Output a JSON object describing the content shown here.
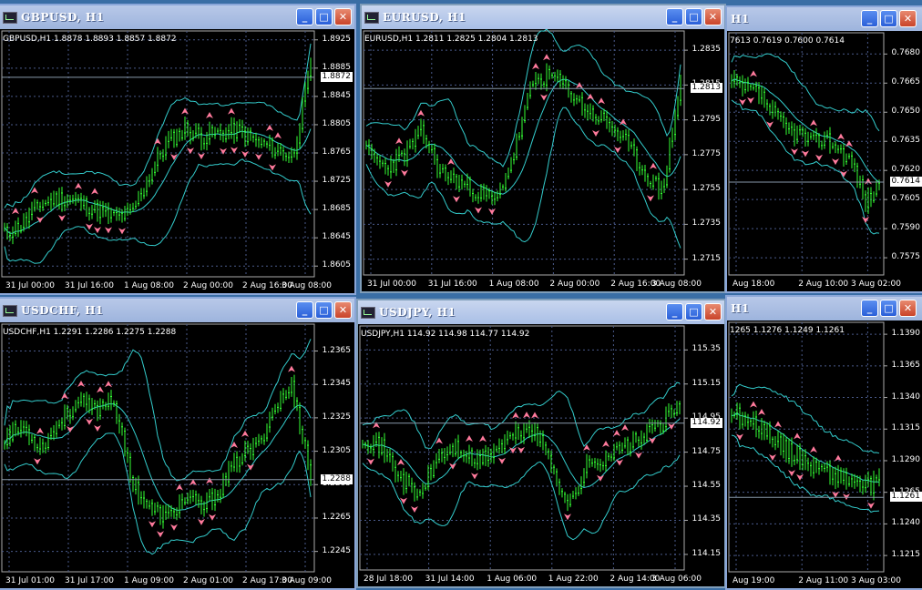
{
  "windows": [
    {
      "id": "gbpusd",
      "title": "GBPUSD, H1",
      "info": "GBPUSD,H1  1.8878 1.8893 1.8857 1.8872",
      "price_tag": "1.8872",
      "price_tag_value": 1.8872,
      "y_labels": [
        "1.8925",
        "1.8885",
        "1.8845",
        "1.8805",
        "1.8765",
        "1.8725",
        "1.8685",
        "1.8645",
        "1.8605"
      ],
      "y_range": [
        1.8595,
        1.8935
      ],
      "x_labels": [
        "31 Jul 00:00",
        "31 Jul 16:00",
        "1 Aug 08:00",
        "2 Aug 00:00",
        "2 Aug 16:00",
        "3 Aug 08:00"
      ],
      "seed": 11,
      "shape": [
        0.1,
        0.15,
        0.25,
        0.28,
        0.26,
        0.22,
        0.18,
        0.2,
        0.38,
        0.55,
        0.62,
        0.58,
        0.6,
        0.61,
        0.55,
        0.52,
        0.48,
        0.92
      ],
      "buttons": {
        "minimize": "_",
        "maximize": "□",
        "close": "✕"
      }
    },
    {
      "id": "eurusd",
      "title": "EURUSD, H1",
      "info": "EURUSD,H1  1.2811 1.2825 1.2804 1.2813",
      "price_tag": "1.2813",
      "price_tag_value": 1.2813,
      "y_labels": [
        "1.2835",
        "1.2815",
        "1.2795",
        "1.2775",
        "1.2755",
        "1.2735",
        "1.2715"
      ],
      "y_range": [
        1.2708,
        1.2845
      ],
      "x_labels": [
        "31 Jul 00:00",
        "31 Jul 16:00",
        "1 Aug 08:00",
        "2 Aug 00:00",
        "2 Aug 16:00",
        "3 Aug 08:00"
      ],
      "seed": 23,
      "shape": [
        0.5,
        0.42,
        0.48,
        0.6,
        0.4,
        0.35,
        0.3,
        0.25,
        0.5,
        0.85,
        0.88,
        0.8,
        0.7,
        0.65,
        0.55,
        0.4,
        0.3,
        0.85
      ],
      "buttons": {
        "minimize": "_",
        "maximize": "□",
        "close": "✕"
      }
    },
    {
      "id": "usdcad",
      "title": "H1",
      "info": "7613 0.7619 0.7600 0.7614",
      "price_tag": "0.7614",
      "price_tag_value": 0.7614,
      "y_labels": [
        "0.7680",
        "0.7665",
        "0.7650",
        "0.7635",
        "0.7620",
        "0.7605",
        "0.7590",
        "0.7575"
      ],
      "y_range": [
        0.7568,
        0.769
      ],
      "x_labels": [
        "Aug 18:00",
        "2 Aug 10:00",
        "3 Aug 02:00"
      ],
      "seed": 37,
      "shape": [
        0.85,
        0.82,
        0.8,
        0.7,
        0.62,
        0.6,
        0.55,
        0.58,
        0.52,
        0.45,
        0.25,
        0.35
      ],
      "buttons": {
        "minimize": "_",
        "maximize": "□",
        "close": "✕"
      }
    },
    {
      "id": "usdchf",
      "title": "USDCHF, H1",
      "info": "USDCHF,H1  1.2291 1.2286 1.2275 1.2288",
      "price_tag": "1.2288",
      "price_tag_value": 1.2288,
      "y_labels": [
        "1.2365",
        "1.2345",
        "1.2325",
        "1.2305",
        "1.2285",
        "1.2265",
        "1.2245"
      ],
      "y_range": [
        1.2235,
        1.238
      ],
      "x_labels": [
        "31 Jul 01:00",
        "31 Jul 17:00",
        "1 Aug 09:00",
        "2 Aug 01:00",
        "2 Aug 17:00",
        "3 Aug 09:00"
      ],
      "seed": 53,
      "shape": [
        0.55,
        0.6,
        0.5,
        0.62,
        0.72,
        0.68,
        0.75,
        0.35,
        0.2,
        0.15,
        0.25,
        0.2,
        0.3,
        0.45,
        0.5,
        0.7,
        0.8,
        0.35
      ],
      "buttons": {
        "minimize": "_",
        "maximize": "□",
        "close": "✕"
      }
    },
    {
      "id": "usdjpy",
      "title": "USDJPY, H1",
      "info": "USDJPY,H1  114.92 114.98 114.77 114.92",
      "price_tag": "114.92",
      "price_tag_value": 114.92,
      "y_labels": [
        "115.35",
        "115.15",
        "114.95",
        "114.75",
        "114.55",
        "114.35",
        "114.15"
      ],
      "y_range": [
        114.08,
        115.48
      ],
      "x_labels": [
        "28 Jul 18:00",
        "31 Jul 14:00",
        "1 Aug 06:00",
        "1 Aug 22:00",
        "2 Aug 14:00",
        "3 Aug 06:00"
      ],
      "seed": 71,
      "shape": [
        0.55,
        0.5,
        0.35,
        0.25,
        0.45,
        0.5,
        0.42,
        0.48,
        0.55,
        0.6,
        0.45,
        0.2,
        0.4,
        0.45,
        0.5,
        0.55,
        0.62,
        0.7
      ],
      "buttons": {
        "minimize": "_",
        "maximize": "□",
        "close": "✕"
      }
    },
    {
      "id": "audusd",
      "title": "H1",
      "info": "1265 1.1276 1.1249 1.1261",
      "price_tag": "1.1261",
      "price_tag_value": 1.1261,
      "y_labels": [
        "1.1390",
        "1.1365",
        "1.1340",
        "1.1315",
        "1.1290",
        "1.1265",
        "1.1240",
        "1.1215"
      ],
      "y_range": [
        1.1205,
        1.1398
      ],
      "x_labels": [
        "Aug 19:00",
        "2 Aug 11:00",
        "3 Aug 03:00"
      ],
      "seed": 89,
      "shape": [
        0.68,
        0.62,
        0.6,
        0.55,
        0.48,
        0.45,
        0.4,
        0.38,
        0.35,
        0.33,
        0.3,
        0.32
      ],
      "buttons": {
        "minimize": "_",
        "maximize": "□",
        "close": "✕"
      }
    }
  ],
  "colors": {
    "background": "#000000",
    "candles": "#33ff33",
    "bands": "#33cccc",
    "fractals": "#ff7a9c",
    "grid": "#4a5a8a"
  }
}
